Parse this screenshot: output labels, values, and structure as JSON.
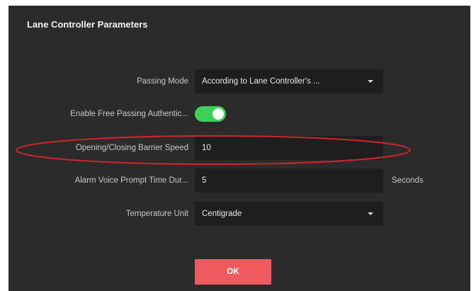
{
  "header": {
    "title": "Lane Controller Parameters"
  },
  "form": {
    "passing_mode": {
      "label": "Passing Mode",
      "value": "According to Lane Controller's ..."
    },
    "free_passing_auth": {
      "label": "Enable Free Passing Authentic...",
      "enabled": true
    },
    "barrier_speed": {
      "label": "Opening/Closing Barrier Speed",
      "value": "10"
    },
    "alarm_voice_prompt": {
      "label": "Alarm Voice Prompt Time Dur...",
      "value": "5",
      "unit": "Seconds"
    },
    "temperature_unit": {
      "label": "Temperature Unit",
      "value": "Centigrade"
    }
  },
  "actions": {
    "ok_label": "OK"
  },
  "colors": {
    "panel_bg": "#2b2b2b",
    "field_bg": "#1e1e1e",
    "toggle_on": "#3ecf5a",
    "ok_button": "#ef5a5e",
    "highlight": "#c0272d"
  }
}
